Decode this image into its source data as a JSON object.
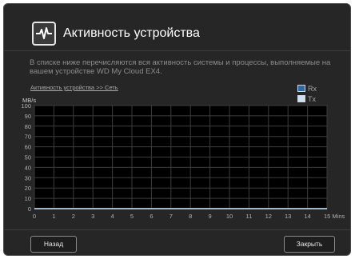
{
  "dialog": {
    "title": "Активность устройства",
    "icon": "activity-pulse-icon",
    "description": "В списке ниже перечисляются вся активность системы и процессы, выполняемые на вашем устройстве WD My Cloud EX4.",
    "breadcrumb": "Активность устройства >> Сеть",
    "unit_label": "MB/s",
    "back_label": "Назад",
    "close_label": "Закрыть"
  },
  "legend": [
    {
      "label": "Rx",
      "color": "#2f6aa3"
    },
    {
      "label": "Tx",
      "color": "#cfe0f0"
    }
  ],
  "chart_data": {
    "type": "line",
    "x": [
      0,
      1,
      2,
      3,
      4,
      5,
      6,
      7,
      8,
      9,
      10,
      11,
      12,
      13,
      14,
      15
    ],
    "xtick_labels": [
      "0",
      "1",
      "2",
      "3",
      "4",
      "5",
      "6",
      "7",
      "8",
      "9",
      "10",
      "11",
      "12",
      "13",
      "14",
      "15 Mins"
    ],
    "ylim": [
      0,
      100
    ],
    "yticks": [
      0,
      10,
      20,
      30,
      40,
      50,
      60,
      70,
      80,
      90,
      100
    ],
    "series": [
      {
        "name": "Rx",
        "color": "#2f6aa3",
        "values": [
          0,
          0,
          0,
          0,
          0,
          0,
          0,
          0,
          0,
          0,
          0,
          0,
          0,
          0,
          0,
          0
        ]
      },
      {
        "name": "Tx",
        "color": "#cfe0f0",
        "values": [
          0,
          0,
          0,
          0,
          0,
          0,
          0,
          0,
          0,
          0,
          0,
          0,
          0,
          0,
          0,
          0
        ]
      }
    ],
    "grid": true
  }
}
